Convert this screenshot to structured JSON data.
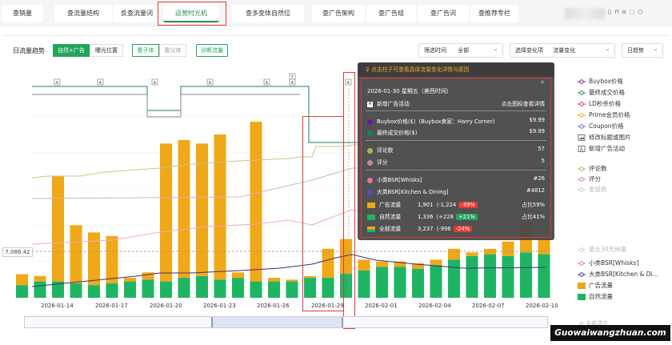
{
  "nav": {
    "tabs": [
      {
        "label": "查销量"
      },
      {
        "label": "查流量结构"
      },
      {
        "label": "反查流量词"
      },
      {
        "label": "运营时光机",
        "active": true
      },
      {
        "label": "查多变体自然位"
      },
      {
        "label": "查广告架构"
      },
      {
        "label": "查广告组"
      },
      {
        "label": "查广告词"
      },
      {
        "label": "查推荐专栏"
      }
    ]
  },
  "toolbar": {
    "title": "日流量趋势",
    "seg1": [
      "自然+广告",
      "曝光位置"
    ],
    "seg2": [
      "看子体",
      "看父体"
    ],
    "diagnose": "诊断流量",
    "filter_time_label": "筛选时间",
    "filter_time_value": "全部",
    "change_label": "选择变化项",
    "change_value": "流量变化",
    "granularity": "日趋势"
  },
  "tooltip": {
    "header": "点击柱子可查看具体流量变化详情与原因",
    "date": "2026-01-30  星期五（美西时间）",
    "ad_event": "新增广告活动",
    "ad_event_link": "点击图标查看详情",
    "buybox_label": "Buybox价格($)（Buybox卖家：Harry Corner)",
    "buybox_value": "$9.99",
    "final_label": "最终成交价格($)",
    "final_value": "$9.99",
    "reviews_label": "评论数",
    "reviews_value": "57",
    "rating_label": "评分",
    "rating_value": "5",
    "sub_bsr_label": "小类BSR[Whisks]",
    "sub_bsr_value": "#26",
    "main_bsr_label": "大类BSR[Kitchen & Dining]",
    "main_bsr_value": "#4812",
    "ad_traffic_label": "广告流量",
    "ad_traffic_value": "1,901（-1,224",
    "ad_traffic_pct": "-39%",
    "ad_traffic_share": "占比59%",
    "organic_label": "自然流量",
    "organic_value": "1,336（+228",
    "organic_pct": "+21%",
    "organic_share": "占比41%",
    "total_label": "全部流量",
    "total_value": "3,237（-996",
    "total_pct": "-24%"
  },
  "legend": [
    {
      "label": "Buybox价格",
      "color": "#6a1b9a",
      "kind": "line"
    },
    {
      "label": "最终成交价格",
      "color": "#1b7f5a",
      "kind": "line"
    },
    {
      "label": "LD秒杀价格",
      "color": "#e91e63",
      "kind": "line"
    },
    {
      "label": "Prime会员价格",
      "color": "#ff9800",
      "kind": "line"
    },
    {
      "label": "Coupon价格",
      "color": "#7e57c2",
      "kind": "line"
    },
    {
      "label": "修改标题或图片",
      "color": "#555555",
      "kind": "img"
    },
    {
      "label": "新增广告活动",
      "color": "#555555",
      "kind": "A"
    },
    {
      "label": "评论数",
      "color": "#b5b25a",
      "kind": "line"
    },
    {
      "label": "评分",
      "color": "#c48b8b",
      "kind": "line"
    },
    {
      "label": "星级数",
      "color": "#cccccc",
      "kind": "line",
      "faded": true
    },
    {
      "label": "最近30天销量",
      "color": "#cccccc",
      "kind": "line",
      "faded": true
    },
    {
      "label": "小类BSR[Whisks]",
      "color": "#e57399",
      "kind": "line"
    },
    {
      "label": "大类BSR[Kitchen & Di...",
      "color": "#3b2f74",
      "kind": "line"
    },
    {
      "label": "广告流量",
      "color": "#f0a818",
      "kind": "bar"
    },
    {
      "label": "自然流量",
      "color": "#1fb463",
      "kind": "bar"
    }
  ],
  "axis": {
    "y_marker": "7,086.42"
  },
  "chart_data": {
    "type": "bar",
    "x": [
      "2026-01-12",
      "2026-01-13",
      "2026-01-14",
      "2026-01-15",
      "2026-01-16",
      "2026-01-17",
      "2026-01-18",
      "2026-01-19",
      "2026-01-20",
      "2026-01-21",
      "2026-01-22",
      "2026-01-23",
      "2026-01-24",
      "2026-01-25",
      "2026-01-26",
      "2026-01-27",
      "2026-01-28",
      "2026-01-29",
      "2026-01-30",
      "2026-01-31",
      "2026-02-01",
      "2026-02-02",
      "2026-02-03",
      "2026-02-04",
      "2026-02-05",
      "2026-02-06",
      "2026-02-07",
      "2026-02-08",
      "2026-02-09",
      "2026-02-10"
    ],
    "tick_labels": [
      "2026-01-14",
      "2026-01-17",
      "2026-01-20",
      "2026-01-23",
      "2026-01-26",
      "2026-01-29",
      "2026-02-01",
      "2026-02-04",
      "2026-02-07",
      "2026-02-10"
    ],
    "series": [
      {
        "name": "自然流量",
        "values": [
          700,
          900,
          900,
          800,
          700,
          800,
          900,
          1000,
          900,
          1100,
          1200,
          1000,
          1100,
          900,
          900,
          900,
          1100,
          1100,
          1336,
          1500,
          1700,
          1700,
          1600,
          1800,
          2100,
          2300,
          2400,
          2300,
          2500,
          2400
        ]
      },
      {
        "name": "广告流量",
        "values": [
          600,
          300,
          5800,
          3200,
          2900,
          2600,
          200,
          400,
          7600,
          7600,
          7300,
          8000,
          300,
          8800,
          200,
          100,
          100,
          1600,
          1901,
          600,
          300,
          300,
          300,
          300,
          600,
          200,
          300,
          800,
          1700,
          900
        ]
      }
    ],
    "ylim": [
      0,
      12000
    ]
  },
  "footer": {
    "clear": "全部清空",
    "watermark": "Guowaiwangzhuan.com"
  }
}
